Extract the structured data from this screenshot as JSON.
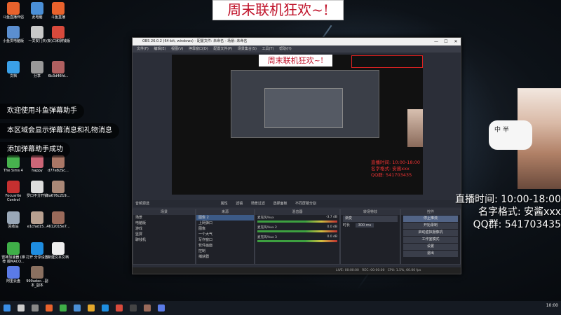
{
  "desktop": {
    "icons": [
      {
        "label": "斗鱼直播伴侣",
        "color": "#e8622c"
      },
      {
        "label": "此电脑",
        "color": "#4a8fd6"
      },
      {
        "label": "斗鱼直播",
        "color": "#e8622c"
      },
      {
        "label": "小鱼贯电脑版",
        "color": "#5b8fd0"
      },
      {
        "label": "一关安门天",
        "color": "#c8c8c8"
      },
      {
        "label": "(新)口和骑钱版",
        "color": "#d84a3c"
      },
      {
        "label": "文档",
        "color": "#3aa0e8"
      },
      {
        "label": "分享",
        "color": "#999999"
      },
      {
        "label": "6b3d46fd...",
        "color": "#b06060"
      },
      {
        "label": "The Sims 4",
        "color": "#47b34e"
      },
      {
        "label": "happy",
        "color": "#cc6677"
      },
      {
        "label": "d77e82Sc...",
        "color": "#aa7766"
      },
      {
        "label": "Focusrite Control",
        "color": "#c53030"
      },
      {
        "label": "罗口不分开锁",
        "color": "#dddddd"
      },
      {
        "label": "6a676c219...",
        "color": "#aa8877"
      },
      {
        "label": "回收站",
        "color": "#9aa8b8"
      },
      {
        "label": "e1cfad15...",
        "color": "#b8a090"
      },
      {
        "label": "4612015e7...",
        "color": "#9a6a5a"
      },
      {
        "label": "雷神加速器 (推荐 版MACO...",
        "color": "#3fae48"
      },
      {
        "label": "打开 分享设置",
        "color": "#1e8de0"
      },
      {
        "label": "新建文本文档",
        "color": "#eeeeee"
      },
      {
        "label": "阿里云盘",
        "color": "#5b7be6"
      },
      {
        "label": "999adec...副本_副本",
        "color": "#8a7060"
      }
    ]
  },
  "overlay_messages": [
    "欢迎使用斗鱼弹幕助手",
    "本区域会显示弹幕消息和礼物消息",
    "添加弹幕助手成功"
  ],
  "banner": {
    "text": "周末联机狂欢~!"
  },
  "obs": {
    "title": "OBS 26.0.2 (64-bit, windows) - 配置文件: 未命名 - 场景: 未命名",
    "menu": [
      "文件(F)",
      "编辑(E)",
      "视图(V)",
      "停靠窗口(D)",
      "配置文件(P)",
      "场景集合(S)",
      "工具(T)",
      "帮助(H)"
    ],
    "preview_banner": "周末联机狂欢~!",
    "preview_lines": [
      "直播时间: 10:00-18:00",
      "名字格式: 安酱xxx",
      "QQ群: 541703435"
    ],
    "toolbar": [
      "音频源选",
      "属性",
      "滤镜",
      "场景过滤",
      "选择面板",
      "不同屏幕分割"
    ],
    "scenes": {
      "header": "场景",
      "items": [
        "场景",
        "电脑版",
        "游戏",
        "竖屏",
        "聊钱机"
      ]
    },
    "sources": {
      "header": "来源",
      "items": [
        "图像 2",
        "上网弹口",
        "图像",
        "一个大气",
        "写作窗口",
        "软件画面",
        "控制",
        "捕获器"
      ]
    },
    "mixer": {
      "header": "混音器",
      "rows": [
        {
          "name": "麦克风/Aux",
          "db": "-3.7 dB"
        },
        {
          "name": "麦克风/Aux 2",
          "db": "0.0 dB"
        },
        {
          "name": "麦克风/Aux 3",
          "db": "0.0 dB"
        }
      ]
    },
    "transitions": {
      "header": "转场特效",
      "type": "渐变",
      "duration_label": "时长",
      "duration": "300 ms"
    },
    "controls": {
      "header": "控件",
      "buttons": [
        "停止推流",
        "开始录制",
        "启动虚拟摄像机",
        "工作室模式",
        "设置",
        "退出"
      ]
    },
    "status": {
      "live": "LIVE: 00:00:00",
      "rec": "REC: 00:00:00",
      "cpu": "CPU: 1.5%, 60.00 fps"
    }
  },
  "right_overlay": {
    "widget_text": "中 半",
    "lines": [
      "直播时间: 10:00-18:00",
      "名字格式: 安酱xxx",
      "QQ群: 541703435"
    ]
  },
  "taskbar": {
    "clock": "10:00"
  }
}
